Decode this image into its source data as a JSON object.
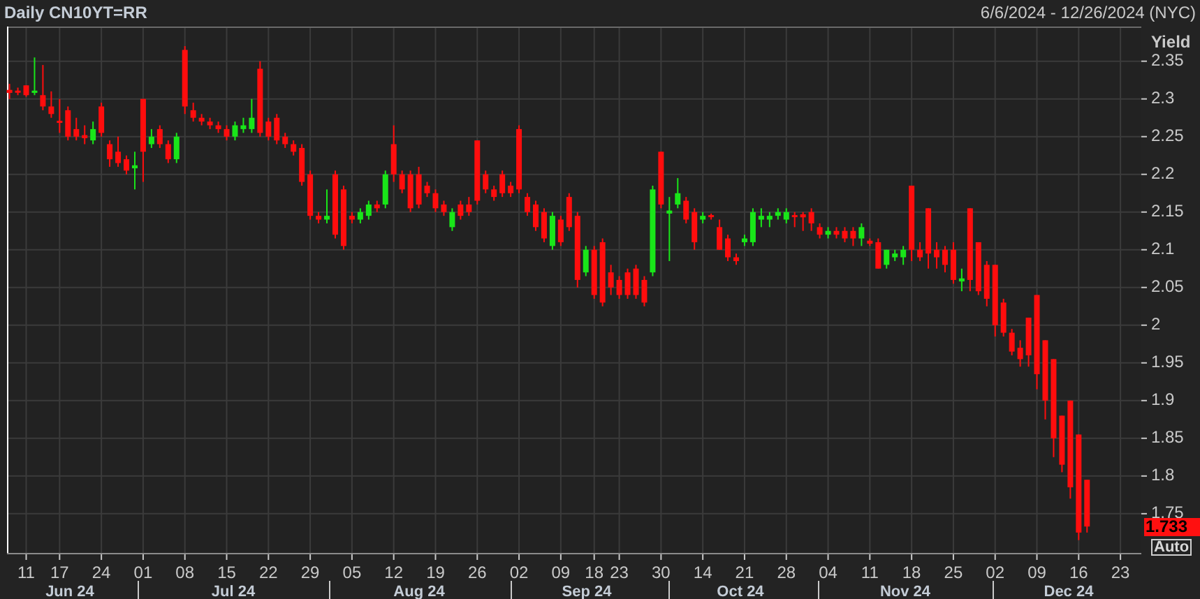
{
  "header": {
    "title": "Daily CN10YT=RR",
    "date_range": "6/6/2024 - 12/26/2024 (NYC)"
  },
  "chart": {
    "chart_data": {
      "type": "candlestick",
      "grid": true,
      "ylabel": "Yield",
      "ylim": [
        1.698,
        2.396
      ],
      "yticks": [
        2.35,
        2.3,
        2.25,
        2.2,
        2.15,
        2.1,
        2.05,
        2,
        1.95,
        1.9,
        1.85,
        1.8,
        1.75
      ],
      "categories": [
        null,
        null,
        "11",
        null,
        null,
        null,
        "17",
        null,
        null,
        null,
        null,
        "24",
        null,
        null,
        null,
        null,
        "01",
        null,
        null,
        null,
        null,
        "08",
        null,
        null,
        null,
        null,
        "15",
        null,
        null,
        null,
        null,
        "22",
        null,
        null,
        null,
        null,
        "29",
        null,
        null,
        null,
        null,
        "05",
        null,
        null,
        null,
        null,
        "12",
        null,
        null,
        null,
        null,
        "19",
        null,
        null,
        null,
        null,
        "26",
        null,
        null,
        null,
        null,
        "02",
        null,
        null,
        null,
        null,
        "09",
        null,
        null,
        null,
        "18",
        null,
        null,
        "23",
        null,
        null,
        null,
        null,
        "30",
        null,
        null,
        null,
        null,
        "14",
        null,
        null,
        null,
        null,
        "21",
        null,
        null,
        null,
        null,
        "28",
        null,
        null,
        null,
        null,
        "04",
        null,
        null,
        null,
        null,
        "11",
        null,
        null,
        null,
        null,
        "18",
        null,
        null,
        null,
        null,
        "25",
        null,
        null,
        null,
        null,
        "02",
        null,
        null,
        null,
        null,
        "09",
        null,
        null,
        null,
        null,
        "16",
        null,
        null,
        null,
        null,
        "23"
      ],
      "ohlc": [
        [
          2.312,
          2.32,
          2.3,
          2.308
        ],
        [
          2.311,
          2.315,
          2.305,
          2.309
        ],
        [
          2.318,
          2.318,
          2.303,
          2.305
        ],
        [
          2.308,
          2.355,
          2.305,
          2.311
        ],
        [
          2.305,
          2.345,
          2.285,
          2.29
        ],
        [
          2.29,
          2.31,
          2.275,
          2.28
        ],
        [
          2.271,
          2.3,
          2.255,
          2.269
        ],
        [
          2.285,
          2.29,
          2.245,
          2.25
        ],
        [
          2.26,
          2.275,
          2.245,
          2.25
        ],
        [
          2.252,
          2.265,
          2.24,
          2.248
        ],
        [
          2.245,
          2.27,
          2.24,
          2.26
        ],
        [
          2.29,
          2.295,
          2.25,
          2.255
        ],
        [
          2.24,
          2.245,
          2.21,
          2.22
        ],
        [
          2.23,
          2.25,
          2.21,
          2.215
        ],
        [
          2.22,
          2.225,
          2.2,
          2.205
        ],
        [
          2.208,
          2.23,
          2.18,
          2.212
        ],
        [
          2.3,
          2.3,
          2.19,
          2.23
        ],
        [
          2.24,
          2.26,
          2.235,
          2.25
        ],
        [
          2.26,
          2.265,
          2.235,
          2.24
        ],
        [
          2.24,
          2.245,
          2.215,
          2.22
        ],
        [
          2.22,
          2.255,
          2.215,
          2.25
        ],
        [
          2.365,
          2.37,
          2.28,
          2.29
        ],
        [
          2.285,
          2.295,
          2.27,
          2.275
        ],
        [
          2.275,
          2.28,
          2.265,
          2.27
        ],
        [
          2.27,
          2.275,
          2.26,
          2.265
        ],
        [
          2.265,
          2.27,
          2.255,
          2.26
        ],
        [
          2.26,
          2.265,
          2.245,
          2.25
        ],
        [
          2.25,
          2.27,
          2.245,
          2.265
        ],
        [
          2.26,
          2.275,
          2.255,
          2.265
        ],
        [
          2.26,
          2.3,
          2.255,
          2.275
        ],
        [
          2.34,
          2.35,
          2.25,
          2.255
        ],
        [
          2.27,
          2.275,
          2.245,
          2.25
        ],
        [
          2.275,
          2.28,
          2.24,
          2.245
        ],
        [
          2.25,
          2.255,
          2.235,
          2.24
        ],
        [
          2.24,
          2.245,
          2.225,
          2.23
        ],
        [
          2.235,
          2.24,
          2.185,
          2.19
        ],
        [
          2.2,
          2.205,
          2.14,
          2.145
        ],
        [
          2.145,
          2.15,
          2.135,
          2.14
        ],
        [
          2.14,
          2.18,
          2.135,
          2.145
        ],
        [
          2.2,
          2.205,
          2.115,
          2.12
        ],
        [
          2.18,
          2.185,
          2.1,
          2.105
        ],
        [
          2.145,
          2.15,
          2.135,
          2.14
        ],
        [
          2.14,
          2.155,
          2.135,
          2.15
        ],
        [
          2.145,
          2.165,
          2.14,
          2.16
        ],
        [
          2.16,
          2.165,
          2.15,
          2.155
        ],
        [
          2.16,
          2.205,
          2.155,
          2.2
        ],
        [
          2.24,
          2.265,
          2.19,
          2.2
        ],
        [
          2.2,
          2.205,
          2.175,
          2.18
        ],
        [
          2.2,
          2.205,
          2.15,
          2.155
        ],
        [
          2.2,
          2.21,
          2.155,
          2.16
        ],
        [
          2.185,
          2.19,
          2.17,
          2.175
        ],
        [
          2.175,
          2.18,
          2.15,
          2.155
        ],
        [
          2.16,
          2.165,
          2.145,
          2.15
        ],
        [
          2.13,
          2.155,
          2.125,
          2.15
        ],
        [
          2.16,
          2.165,
          2.14,
          2.145
        ],
        [
          2.16,
          2.17,
          2.145,
          2.15
        ],
        [
          2.245,
          2.245,
          2.16,
          2.165
        ],
        [
          2.2,
          2.205,
          2.175,
          2.18
        ],
        [
          2.18,
          2.185,
          2.165,
          2.17
        ],
        [
          2.2,
          2.205,
          2.17,
          2.175
        ],
        [
          2.185,
          2.19,
          2.17,
          2.175
        ],
        [
          2.26,
          2.265,
          2.175,
          2.18
        ],
        [
          2.17,
          2.175,
          2.145,
          2.15
        ],
        [
          2.16,
          2.165,
          2.125,
          2.13
        ],
        [
          2.15,
          2.155,
          2.11,
          2.115
        ],
        [
          2.105,
          2.15,
          2.1,
          2.145
        ],
        [
          2.14,
          2.145,
          2.105,
          2.11
        ],
        [
          2.17,
          2.175,
          2.125,
          2.13
        ],
        [
          2.145,
          2.15,
          2.05,
          2.06
        ],
        [
          2.07,
          2.105,
          2.065,
          2.1
        ],
        [
          2.1,
          2.105,
          2.035,
          2.04
        ],
        [
          2.11,
          2.115,
          2.025,
          2.03
        ],
        [
          2.07,
          2.08,
          2.04,
          2.05
        ],
        [
          2.06,
          2.065,
          2.035,
          2.04
        ],
        [
          2.07,
          2.075,
          2.035,
          2.04
        ],
        [
          2.075,
          2.08,
          2.035,
          2.04
        ],
        [
          2.06,
          2.065,
          2.025,
          2.03
        ],
        [
          2.07,
          2.185,
          2.065,
          2.18
        ],
        [
          2.23,
          2.23,
          2.155,
          2.16
        ],
        [
          2.148,
          2.17,
          2.085,
          2.152
        ],
        [
          2.16,
          2.195,
          2.155,
          2.175
        ],
        [
          2.165,
          2.17,
          2.135,
          2.14
        ],
        [
          2.15,
          2.155,
          2.1,
          2.11
        ],
        [
          2.14,
          2.15,
          2.135,
          2.145
        ],
        [
          2.146,
          2.148,
          2.14,
          2.144
        ],
        [
          2.13,
          2.14,
          2.1,
          2.1
        ],
        [
          2.115,
          2.12,
          2.085,
          2.09
        ],
        [
          2.09,
          2.095,
          2.08,
          2.085
        ],
        [
          2.11,
          2.12,
          2.105,
          2.115
        ],
        [
          2.11,
          2.155,
          2.105,
          2.15
        ],
        [
          2.14,
          2.155,
          2.13,
          2.145
        ],
        [
          2.14,
          2.15,
          2.13,
          2.145
        ],
        [
          2.145,
          2.155,
          2.14,
          2.15
        ],
        [
          2.14,
          2.155,
          2.135,
          2.15
        ],
        [
          2.146,
          2.15,
          2.13,
          2.144
        ],
        [
          2.147,
          2.15,
          2.125,
          2.143
        ],
        [
          2.15,
          2.155,
          2.125,
          2.135
        ],
        [
          2.13,
          2.135,
          2.115,
          2.12
        ],
        [
          2.12,
          2.13,
          2.115,
          2.125
        ],
        [
          2.125,
          2.13,
          2.115,
          2.12
        ],
        [
          2.125,
          2.13,
          2.11,
          2.115
        ],
        [
          2.125,
          2.13,
          2.105,
          2.115
        ],
        [
          2.115,
          2.135,
          2.105,
          2.13
        ],
        [
          2.112,
          2.115,
          2.105,
          2.108
        ],
        [
          2.11,
          2.115,
          2.075,
          2.075
        ],
        [
          2.08,
          2.1,
          2.075,
          2.1
        ],
        [
          2.09,
          2.1,
          2.085,
          2.095
        ],
        [
          2.09,
          2.105,
          2.08,
          2.1
        ],
        [
          2.185,
          2.185,
          2.085,
          2.1
        ],
        [
          2.1,
          2.11,
          2.085,
          2.09
        ],
        [
          2.155,
          2.155,
          2.075,
          2.095
        ],
        [
          2.1,
          2.11,
          2.075,
          2.09
        ],
        [
          2.1,
          2.105,
          2.07,
          2.08
        ],
        [
          2.1,
          2.11,
          2.055,
          2.06
        ],
        [
          2.058,
          2.075,
          2.045,
          2.062
        ],
        [
          2.155,
          2.155,
          2.045,
          2.06
        ],
        [
          2.11,
          2.11,
          2.04,
          2.045
        ],
        [
          2.08,
          2.085,
          2.025,
          2.035
        ],
        [
          2.08,
          2.08,
          1.985,
          2
        ],
        [
          2.03,
          2.035,
          1.985,
          1.99
        ],
        [
          1.99,
          1.995,
          1.96,
          1.965
        ],
        [
          1.97,
          1.98,
          1.945,
          1.955
        ],
        [
          2.01,
          2.01,
          1.945,
          1.96
        ],
        [
          2.04,
          2.04,
          1.915,
          1.935
        ],
        [
          1.98,
          1.98,
          1.875,
          1.9
        ],
        [
          1.955,
          1.955,
          1.825,
          1.85
        ],
        [
          1.88,
          1.88,
          1.805,
          1.815
        ],
        [
          1.9,
          1.9,
          1.77,
          1.785
        ],
        [
          1.855,
          1.855,
          1.715,
          1.725
        ],
        [
          1.795,
          1.795,
          1.725,
          1.733
        ],
        null,
        null,
        null,
        null
      ]
    },
    "last_price": "1.733",
    "auto_button": "Auto",
    "months": [
      "Jun 24",
      "Jul 24",
      "Aug 24",
      "Sep 24",
      "Oct 24",
      "Nov 24",
      "Dec 24"
    ]
  }
}
